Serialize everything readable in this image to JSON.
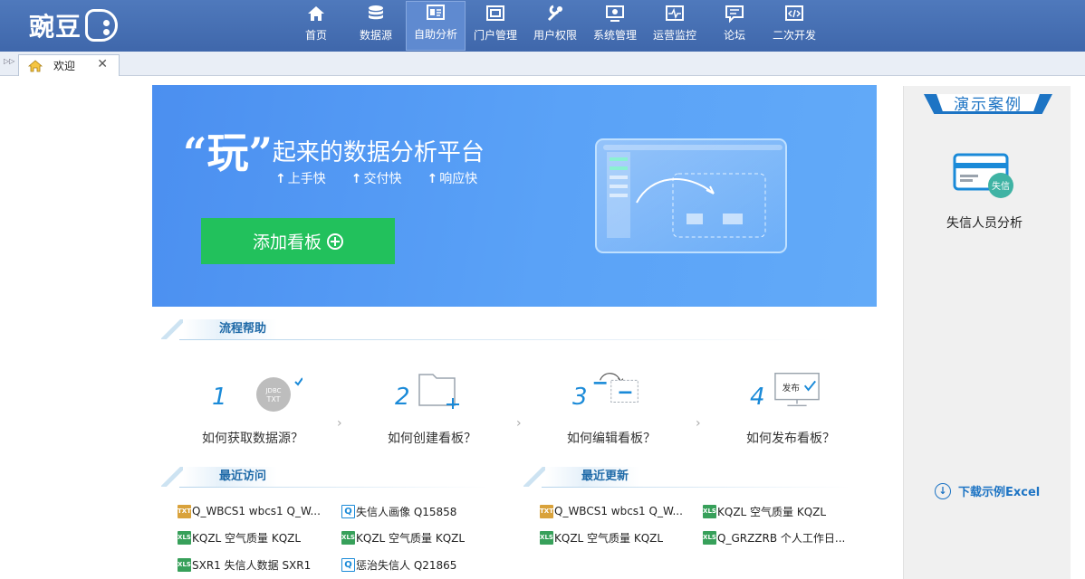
{
  "app": {
    "logo_text": "豌豆"
  },
  "nav": {
    "items": [
      {
        "label": "首页",
        "icon": "home-icon"
      },
      {
        "label": "数据源",
        "icon": "database-icon"
      },
      {
        "label": "自助分析",
        "icon": "analysis-icon",
        "active": true
      },
      {
        "label": "门户管理",
        "icon": "portal-icon"
      },
      {
        "label": "用户权限",
        "icon": "wrench-icon"
      },
      {
        "label": "系统管理",
        "icon": "monitor-icon"
      },
      {
        "label": "运营监控",
        "icon": "pulse-icon"
      },
      {
        "label": "论坛",
        "icon": "forum-icon"
      },
      {
        "label": "二次开发",
        "icon": "code-icon"
      }
    ]
  },
  "tabs": {
    "welcome_label": "欢迎",
    "close_glyph": "✕"
  },
  "banner": {
    "quote": "“玩”",
    "subtitle": "起来的数据分析平台",
    "features": [
      "上手快",
      "交付快",
      "响应快"
    ],
    "add_button": "添加看板"
  },
  "process": {
    "title": "流程帮助",
    "steps": [
      {
        "num": "1",
        "text": "如何获取数据源？",
        "icon": "jdbc-txt-icon"
      },
      {
        "num": "2",
        "text": "如何创建看板？",
        "icon": "new-folder-icon"
      },
      {
        "num": "3",
        "text": "如何编辑看板？",
        "icon": "edit-board-icon"
      },
      {
        "num": "4",
        "text": "如何发布看板？",
        "icon": "publish-icon"
      }
    ],
    "jdbc_label_1": "JDBC",
    "jdbc_label_2": "TXT",
    "publish_label": "发布"
  },
  "recent_visits": {
    "title": "最近访问",
    "items": [
      {
        "type": "txt",
        "name": "Q_WBCS1 wbcs1 Q_W..."
      },
      {
        "type": "q",
        "name": "失信人画像 Q15858"
      },
      {
        "type": "xls",
        "name": "KQZL 空气质量 KQZL"
      },
      {
        "type": "xls",
        "name": "KQZL 空气质量 KQZL"
      },
      {
        "type": "xls",
        "name": "SXR1 失信人数据 SXR1"
      },
      {
        "type": "q",
        "name": "惩治失信人 Q21865"
      }
    ]
  },
  "recent_updates": {
    "title": "最近更新",
    "items": [
      {
        "type": "txt",
        "name": "Q_WBCS1 wbcs1 Q_W..."
      },
      {
        "type": "xls",
        "name": "KQZL 空气质量 KQZL"
      },
      {
        "type": "xls",
        "name": "KQZL 空气质量 KQZL"
      },
      {
        "type": "xls",
        "name": "Q_GRZZRB 个人工作日..."
      }
    ]
  },
  "sidebar": {
    "title": "演示案例",
    "demo_label": "失信人员分析",
    "demo_badge": "失信",
    "download_label": "下载示例Excel"
  },
  "file_icon_labels": {
    "txt": "TXT",
    "xls": "XLS",
    "q": "Q"
  }
}
